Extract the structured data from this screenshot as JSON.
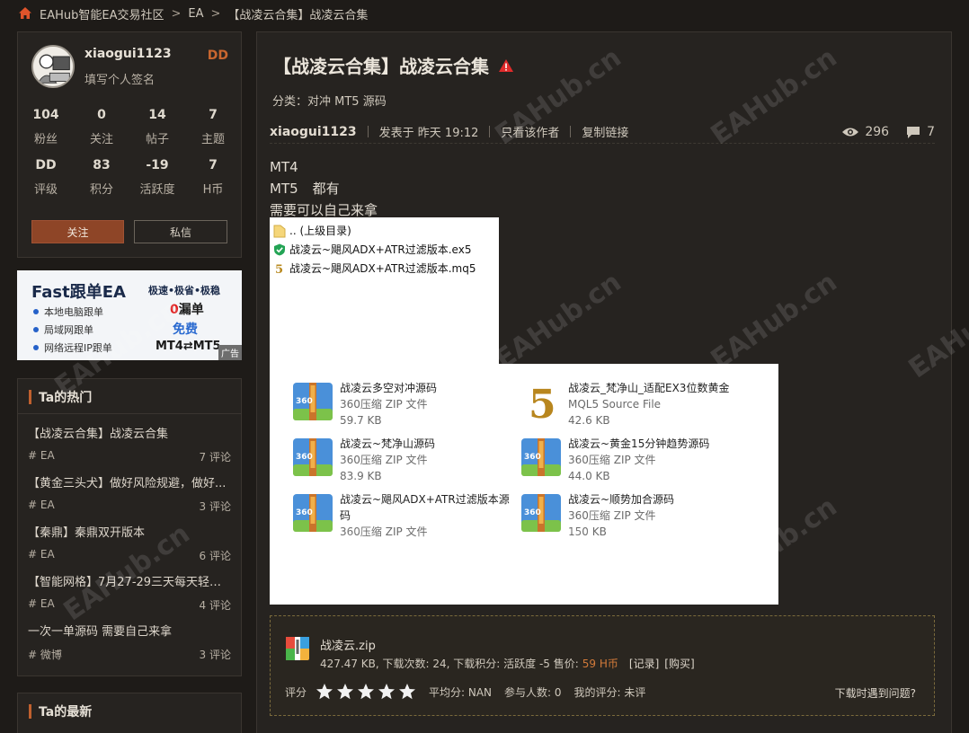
{
  "breadcrumb": {
    "home": "EAHub智能EA交易社区",
    "sep": ">",
    "category": "EA",
    "current": "【战凌云合集】战凌云合集"
  },
  "profile": {
    "username": "xiaogui1123",
    "signature": "填写个人签名",
    "level": "DD",
    "stats_row1": [
      {
        "value": "104",
        "label": "粉丝"
      },
      {
        "value": "0",
        "label": "关注"
      },
      {
        "value": "14",
        "label": "帖子"
      },
      {
        "value": "7",
        "label": "主题"
      }
    ],
    "stats_row2": [
      {
        "value": "DD",
        "label": "评级"
      },
      {
        "value": "83",
        "label": "积分"
      },
      {
        "value": "-19",
        "label": "活跃度"
      },
      {
        "value": "7",
        "label": "H币"
      }
    ],
    "follow_label": "关注",
    "message_label": "私信"
  },
  "ad": {
    "title": "Fast跟单EA",
    "tagline": "极速•极省•极稳",
    "rows": [
      "本地电脑跟单",
      "局域网跟单",
      "网络远程IP跟单"
    ],
    "zero": "0",
    "leak": "漏单",
    "free": "免费",
    "mt": "MT4⇄MT5",
    "tag": "广告"
  },
  "hot": {
    "title": "Ta的热门",
    "items": [
      {
        "title": "【战凌云合集】战凌云合集",
        "tag": "# EA",
        "comments": "7 评论"
      },
      {
        "title": "【黄金三头犬】做好风险规避，做好...",
        "tag": "# EA",
        "comments": "3 评论"
      },
      {
        "title": "【秦鼎】秦鼎双开版本",
        "tag": "# EA",
        "comments": "6 评论"
      },
      {
        "title": "【智能网格】7月27-29三天每天轻松...",
        "tag": "# EA",
        "comments": "4 评论"
      },
      {
        "title": "一次一单源码 需要自己来拿",
        "tag": "# 微博",
        "comments": "3 评论"
      }
    ]
  },
  "newest": {
    "title": "Ta的最新"
  },
  "post": {
    "title": "【战凌云合集】战凌云合集",
    "category": "分类：对冲 MT5 源码",
    "author": "xiaogui1123",
    "posted": "发表于 昨天 19:12",
    "only_author": "只看该作者",
    "copy_link": "复制链接",
    "views": "296",
    "comments": "7",
    "line1": "MT4",
    "line2a": "MT5",
    "line2b": "都有",
    "line3": "需要可以自己来拿"
  },
  "shot1": {
    "parent": ".. (上级目录)",
    "file1": "战凌云~飓风ADX+ATR过滤版本.ex5",
    "file2": "战凌云~飓风ADX+ATR过滤版本.mq5"
  },
  "shot2": {
    "files": [
      {
        "name": "战凌云多空对冲源码",
        "type": "360压缩 ZIP 文件",
        "size": "59.7 KB",
        "icon": "zip"
      },
      {
        "name": "战凌云_梵净山_适配EX3位数黄金",
        "type": "MQL5 Source File",
        "size": "42.6 KB",
        "icon": "mql5"
      },
      {
        "name": "战凌云~梵净山源码",
        "type": "360压缩 ZIP 文件",
        "size": "83.9 KB",
        "icon": "zip"
      },
      {
        "name": "战凌云~黄金15分钟趋势源码",
        "type": "360压缩 ZIP 文件",
        "size": "44.0 KB",
        "icon": "zip"
      },
      {
        "name": "战凌云~飓风ADX+ATR过滤版本源",
        "name2": "码",
        "type": "360压缩 ZIP 文件",
        "size": "",
        "icon": "zip"
      },
      {
        "name": "战凌云~顺势加合源码",
        "type": "360压缩 ZIP 文件",
        "size": "150 KB",
        "icon": "zip"
      }
    ]
  },
  "attachment": {
    "filename": "战凌云.zip",
    "info": "427.47 KB, 下载次数: 24, 下载积分: 活跃度 -5 售价:",
    "price": "59 H币",
    "record": "[记录]",
    "buy": "[购买]",
    "rating_label": "评分",
    "avg": "平均分: NAN",
    "participants": "参与人数: 0",
    "mine": "我的评分: 未评",
    "help": "下载时遇到问题?"
  },
  "watermark": "EAHub.cn",
  "colors": {
    "accent": "#c8662f",
    "follow_btn": "#8e4527",
    "price": "#d27a3a",
    "warn": "#e02b2b"
  }
}
